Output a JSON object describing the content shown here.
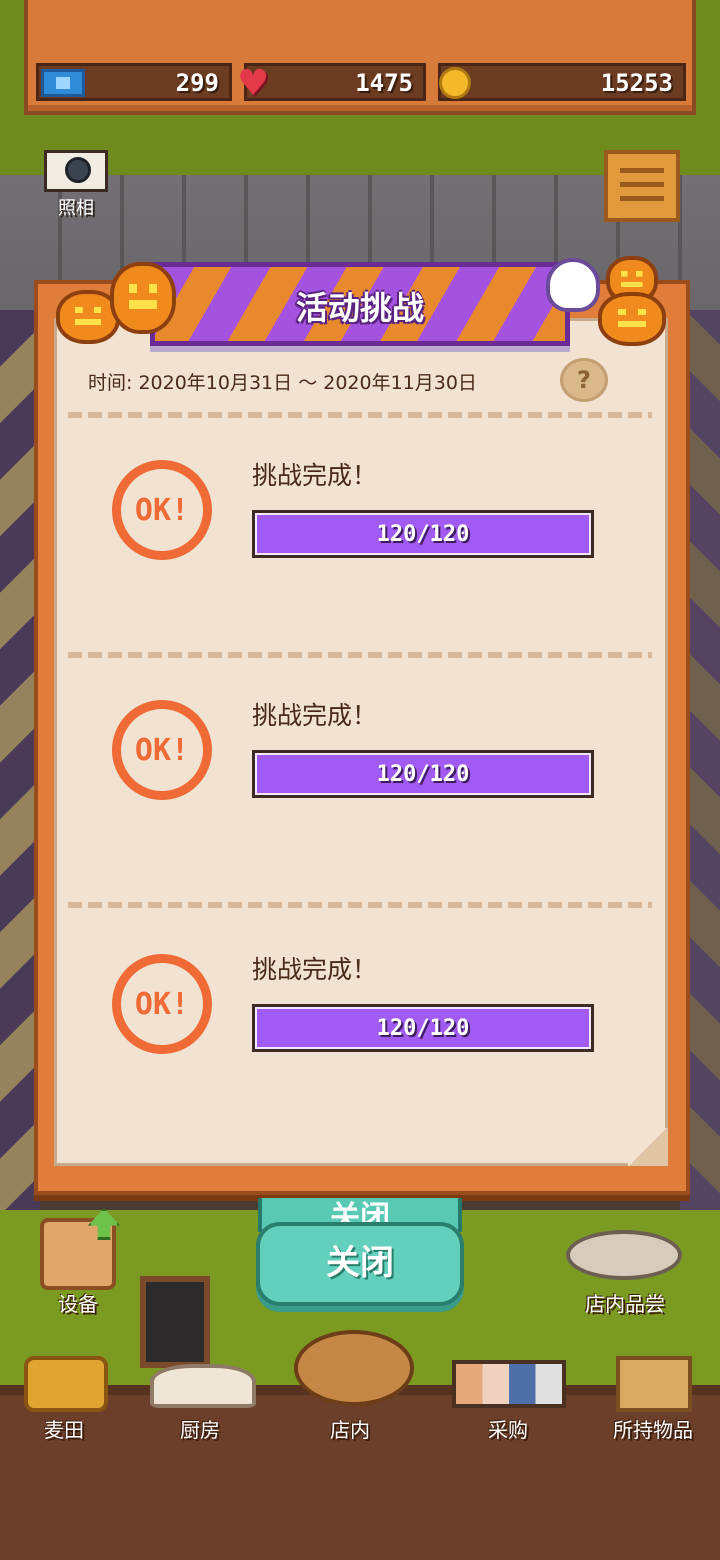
{
  "resources": {
    "tickets": "299",
    "hearts": "1475",
    "coins": "15253"
  },
  "side_buttons": {
    "camera_label": "照相"
  },
  "modal": {
    "title": "活动挑战",
    "date_range": "时间: 2020年10月31日 ～ 2020年11月30日",
    "help_symbol": "?",
    "challenges": [
      {
        "stamp": "OK!",
        "status": "挑战完成！",
        "progress_text": "120/120",
        "progress": 1.0
      },
      {
        "stamp": "OK!",
        "status": "挑战完成！",
        "progress_text": "120/120",
        "progress": 1.0
      },
      {
        "stamp": "OK!",
        "status": "挑战完成！",
        "progress_text": "120/120",
        "progress": 1.0
      }
    ],
    "close_ghost_label": "关闭",
    "close_label": "关闭"
  },
  "hud": {
    "equipment": "设备",
    "tasting": "店内品尝",
    "wheat_field": "麦田",
    "kitchen": "厨房",
    "store": "店内",
    "purchase": "采购",
    "inventory": "所持物品"
  },
  "colors": {
    "accent_purple": "#a15bf2",
    "stamp_orange": "#f06a36",
    "close_teal": "#62d0bc",
    "frame_orange": "#e07d3a"
  },
  "icons": [
    "ticket-icon",
    "heart-icon",
    "coin-icon",
    "camera-icon",
    "newspaper-icon",
    "help-icon",
    "ok-stamp-icon",
    "upgrade-arrow-icon"
  ]
}
